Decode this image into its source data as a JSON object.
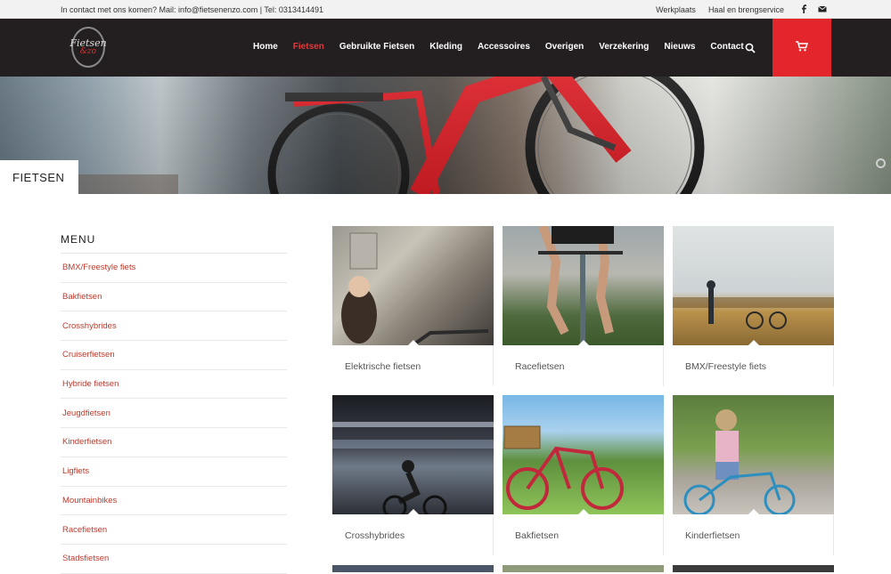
{
  "topbar": {
    "contact": "In contact met ons komen? Mail: info@fietsenenzo.com | Tel: 0313414491",
    "links": [
      "Werkplaats",
      "Haal en brengservice"
    ]
  },
  "logo": {
    "line1": "Fietsen",
    "line2": "&zo"
  },
  "nav": {
    "items": [
      "Home",
      "Fietsen",
      "Gebruikte Fietsen",
      "Kleding",
      "Accessoires",
      "Overigen",
      "Verzekering",
      "Nieuws",
      "Contact"
    ],
    "active": "Fietsen"
  },
  "banner": {
    "page_title": "FIETSEN"
  },
  "sidebar": {
    "title": "MENU",
    "items": [
      "BMX/Freestyle fiets",
      "Bakfietsen",
      "Crosshybrides",
      "Cruiserfietsen",
      "Hybride fietsen",
      "Jeugdfietsen",
      "Kinderfietsen",
      "Ligfiets",
      "Mountainbikes",
      "Racefietsen",
      "Stadsfietsen"
    ]
  },
  "categories": [
    "Elektrische fietsen",
    "Racefietsen",
    "BMX/Freestyle fiets",
    "Crosshybrides",
    "Bakfietsen",
    "Kinderfietsen"
  ],
  "colors": {
    "accent": "#e2262b",
    "header_bg": "#231f20",
    "link": "#c0392b"
  }
}
